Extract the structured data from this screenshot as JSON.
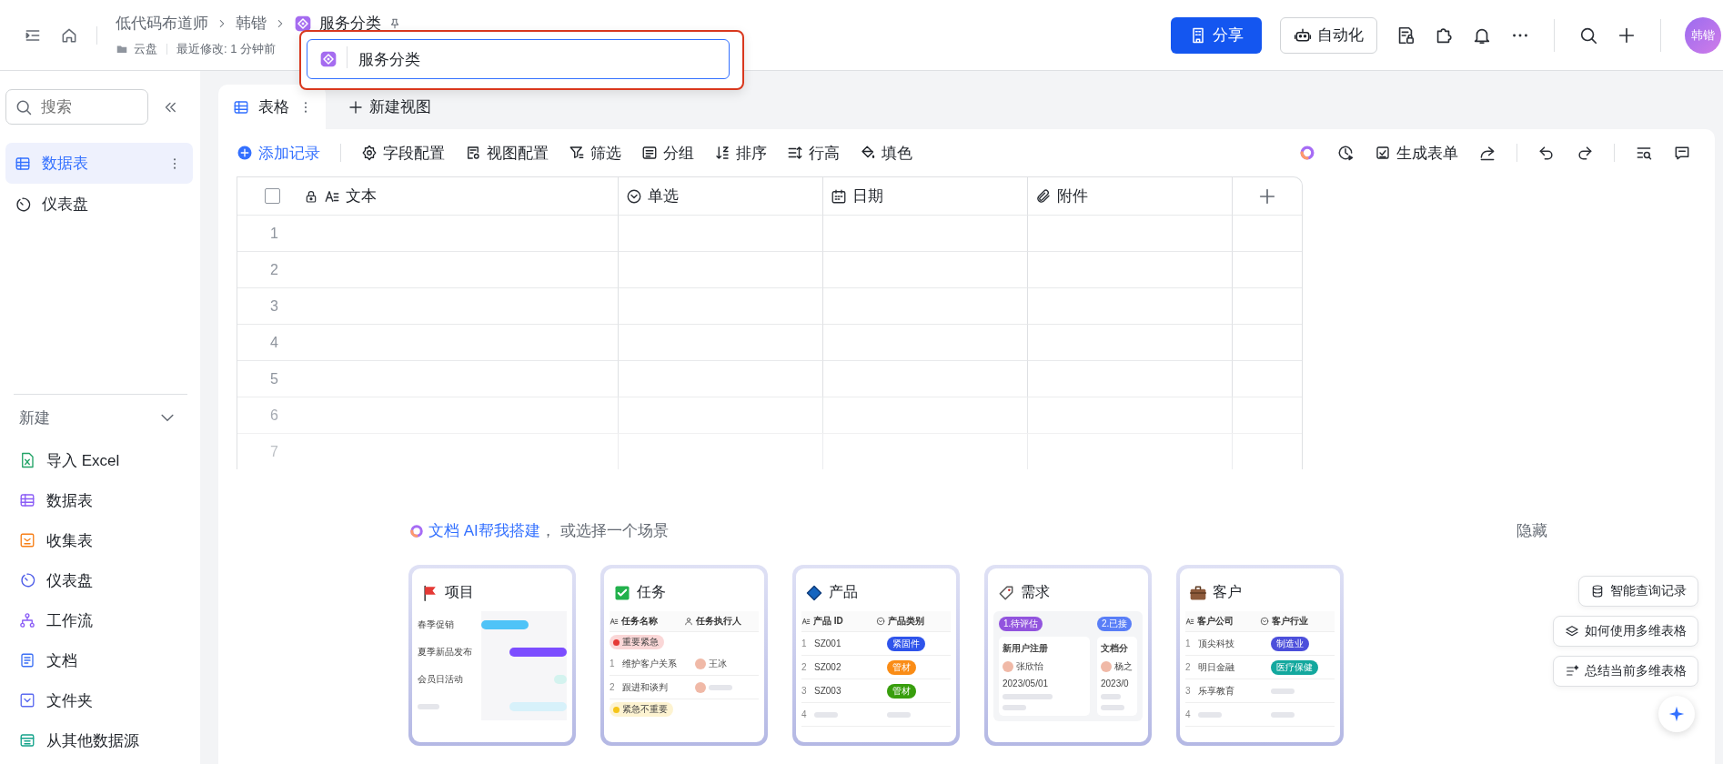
{
  "topbar": {
    "breadcrumbs": [
      "低代码布道师",
      "韩锴"
    ],
    "doc_title": "服务分类",
    "location": "云盘",
    "modified": "最近修改: 1 分钟前",
    "share_button": "分享",
    "automation_button": "自动化",
    "avatar": "韩锴"
  },
  "rename_popup": {
    "value": "服务分类"
  },
  "sidebar": {
    "search": {
      "placeholder": "搜索"
    },
    "items": [
      {
        "label": "数据表",
        "selected": true
      },
      {
        "label": "仪表盘",
        "selected": false
      }
    ],
    "new_section": {
      "label": "新建",
      "expanded": true,
      "items": [
        "导入 Excel",
        "数据表",
        "收集表",
        "仪表盘",
        "工作流",
        "文档",
        "文件夹",
        "从其他数据源"
      ]
    }
  },
  "views": {
    "tabs": [
      {
        "label": "表格",
        "selected": true
      }
    ],
    "new_view": "新建视图"
  },
  "toolbar": {
    "add_record": "添加记录",
    "tools": [
      "字段配置",
      "视图配置",
      "筛选",
      "分组",
      "排序",
      "行高",
      "填色"
    ],
    "generate_form": "生成表单"
  },
  "table": {
    "all_selected": false,
    "columns": [
      "文本",
      "单选",
      "日期",
      "附件"
    ],
    "rows": [
      "1",
      "2",
      "3",
      "4",
      "5",
      "6",
      "7"
    ]
  },
  "templates": {
    "prompt_link": "文档 AI帮我搭建",
    "prompt_rest": "， 或选择一个场景",
    "hide": "隐藏",
    "cards": [
      {
        "title": "项目",
        "kind": "gantt",
        "rows": [
          "春季促销",
          "夏季新品发布",
          "会员日活动"
        ]
      },
      {
        "title": "任务",
        "kind": "task",
        "columns": [
          "任务名称",
          "任务执行人"
        ],
        "groups": [
          {
            "tag": "重要紧急",
            "color": "#e53935",
            "rows": [
              {
                "num": "1",
                "name": "维护客户关系",
                "person": "王冰"
              },
              {
                "num": "2",
                "name": "跟进和谈判"
              }
            ]
          },
          {
            "tag": "紧急不重要",
            "color": "#f5c518"
          }
        ]
      },
      {
        "title": "产品",
        "kind": "table",
        "columns": [
          "产品 ID",
          "产品类别"
        ],
        "rows": [
          {
            "num": "1",
            "name": "SZ001",
            "tag": "紧固件",
            "color": "#2f54eb"
          },
          {
            "num": "2",
            "name": "SZ002",
            "tag": "管材",
            "color": "#fa8c16"
          },
          {
            "num": "3",
            "name": "SZ003",
            "tag": "管材",
            "color": "#389e0d"
          },
          {
            "num": "4"
          }
        ]
      },
      {
        "title": "需求",
        "kind": "kanban",
        "lanes": [
          {
            "label": "1.待评估",
            "color": "#9254de",
            "card": {
              "title": "新用户注册",
              "person": "张欣怡",
              "date": "2023/05/01"
            }
          },
          {
            "label": "2.已接",
            "color": "#597ef7",
            "card": {
              "title": "文档分",
              "person": "杨之",
              "date": "2023/0"
            }
          }
        ]
      },
      {
        "title": "客户",
        "kind": "table",
        "columns": [
          "客户公司",
          "客户行业"
        ],
        "rows": [
          {
            "num": "1",
            "name": "顶尖科技",
            "tag": "制造业",
            "color": "#4c4fdb"
          },
          {
            "num": "2",
            "name": "明日金融",
            "tag": "医疗保健",
            "color": "#13a89e"
          },
          {
            "num": "3",
            "name": "乐享教育"
          },
          {
            "num": "4"
          }
        ]
      }
    ]
  },
  "assistant": {
    "actions": [
      "智能查询记录",
      "如何使用多维表格",
      "总结当前多维表格"
    ]
  }
}
